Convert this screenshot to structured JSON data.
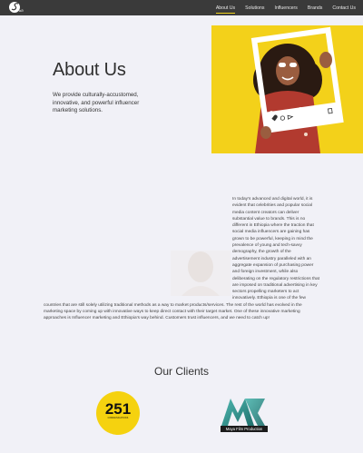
{
  "brand": {
    "logo_text": "Salt"
  },
  "nav": {
    "items": [
      {
        "label": "About Us",
        "active": true
      },
      {
        "label": "Solutions",
        "active": false
      },
      {
        "label": "Influencers",
        "active": false
      },
      {
        "label": "Brands",
        "active": false
      },
      {
        "label": "Contact Us",
        "active": false
      }
    ]
  },
  "hero": {
    "title": "About Us",
    "tagline": "We provide culturally-accustomed, innovative, and powerful influencer marketing solutions."
  },
  "about": {
    "body": "In today's advanced and digital world, it is evident that celebrities and popular social media content creators can deliver substantial value to brands. This is no different in Ethiopia where the traction that social media influencers are gaining has grown to be powerful, keeping in mind the prevalence of young and tech-savvy demography, the growth of the advertisement industry paralleled with an aggregate expansion of purchasing power and foreign investment, while also deliberating on the regulatory restrictions that are imposed on traditional advertising in key sectors propelling marketers to act innovatively. Ethiopia is one of the few countries that are still solely utilizing traditional methods as a way to market products/services. The rest of the world has evolved in the marketing space by coming up with innovative ways to keep direct contact with their target market. One of these innovative marketing approaches is Influencer marketing and Ethiopia's way behind. Customers trust influencers, and we need to catch up!"
  },
  "clients": {
    "title": "Our Clients",
    "logos": [
      {
        "text": "251",
        "subtext": "COMMUNICATIONS"
      },
      {
        "text": "MAYA",
        "caption": "Maya Film Production"
      }
    ]
  },
  "colors": {
    "accent": "#f3d11a",
    "topbar": "#3a3a3a",
    "background": "#f1f1f7"
  }
}
